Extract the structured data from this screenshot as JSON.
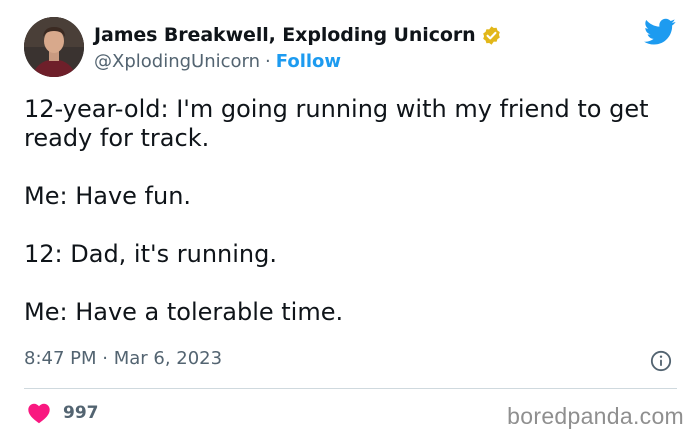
{
  "author": {
    "display_name": "James Breakwell, Exploding Unicorn",
    "handle": "@XplodingUnicorn",
    "separator": "·",
    "follow_label": "Follow",
    "verified": true
  },
  "tweet": {
    "text": "12-year-old: I'm going running with my friend to get ready for track.\n\nMe: Have fun.\n\n12: Dad, it's running.\n\nMe: Have a tolerable time.",
    "timestamp": "8:47 PM · Mar 6, 2023",
    "like_count": "997"
  },
  "icons": {
    "verified": "verified-badge-icon",
    "brand": "twitter-bird-icon",
    "info": "info-icon",
    "like": "heart-icon"
  },
  "colors": {
    "accent": "#1d9bf0",
    "verified_gold": "#e2b719",
    "heart": "#f91880",
    "secondary_text": "#536471"
  },
  "watermark": "boredpanda.com"
}
